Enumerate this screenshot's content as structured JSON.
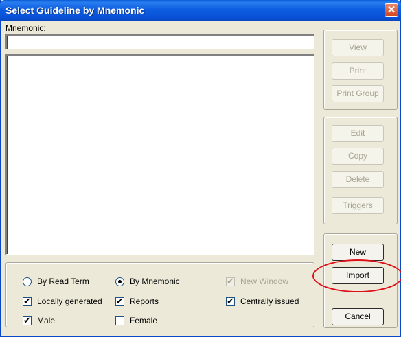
{
  "window": {
    "title": "Select Guideline by Mnemonic",
    "close_glyph": "✕"
  },
  "mnemonic": {
    "label": "Mnemonic:",
    "value": ""
  },
  "buttons_top": [
    {
      "label": "View",
      "enabled": false
    },
    {
      "label": "Print",
      "enabled": false
    },
    {
      "label": "Print Group",
      "enabled": false
    }
  ],
  "buttons_mid": [
    {
      "label": "Edit",
      "enabled": false
    },
    {
      "label": "Copy",
      "enabled": false
    },
    {
      "label": "Delete",
      "enabled": false
    },
    {
      "label": "Triggers",
      "enabled": false
    }
  ],
  "buttons_bottom": [
    {
      "label": "New",
      "enabled": true
    },
    {
      "label": "Import",
      "enabled": true
    },
    {
      "label": "Cancel",
      "enabled": true
    }
  ],
  "options": {
    "by_read_term": {
      "label": "By Read Term",
      "checked": false
    },
    "by_mnemonic": {
      "label": "By Mnemonic",
      "checked": true
    },
    "new_window": {
      "label": "New Window",
      "checked": true,
      "enabled": false
    },
    "locally_generated": {
      "label": "Locally generated",
      "checked": true
    },
    "reports": {
      "label": "Reports",
      "checked": true
    },
    "centrally_issued": {
      "label": "Centrally issued",
      "checked": true
    },
    "male": {
      "label": "Male",
      "checked": true
    },
    "female": {
      "label": "Female",
      "checked": false
    }
  },
  "colors": {
    "title_bar": "#0a5fd8",
    "dialog_bg": "#ece9d8",
    "highlight_ring": "#e0101a",
    "close_button": "#d2441c"
  }
}
